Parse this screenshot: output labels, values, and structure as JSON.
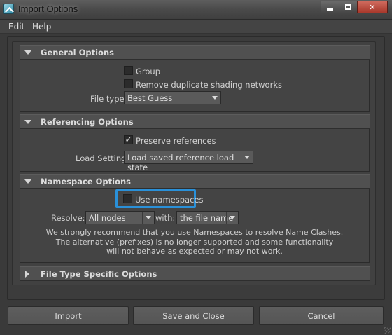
{
  "window": {
    "title": "Import Options"
  },
  "menu": {
    "items": [
      "Edit",
      "Help"
    ]
  },
  "sections": {
    "general": {
      "title": "General Options",
      "group_label": "Group",
      "group_checked": false,
      "remove_dup_label": "Remove duplicate shading networks",
      "remove_dup_checked": false,
      "file_type_label": "File type:",
      "file_type_value": "Best Guess"
    },
    "referencing": {
      "title": "Referencing Options",
      "preserve_label": "Preserve references",
      "preserve_checked": true,
      "load_settings_label": "Load Settings",
      "load_settings_value": "Load saved reference load state"
    },
    "namespace": {
      "title": "Namespace Options",
      "use_ns_label": "Use namespaces",
      "use_ns_checked": false,
      "resolve_label": "Resolve:",
      "resolve_value": "All nodes",
      "with_label": "with:",
      "with_value": "the file name",
      "info_lines": [
        "We strongly recommend that you use Namespaces to resolve Name Clashes.",
        "The alternative (prefixes) is no longer supported and some functionality",
        "will not behave as expected or may not work."
      ]
    },
    "file_type_specific": {
      "title": "File Type Specific Options"
    }
  },
  "buttons": {
    "import": "Import",
    "save_close": "Save and Close",
    "cancel": "Cancel"
  },
  "colors": {
    "highlight": "#2a90d8",
    "background": "#3a3a3a"
  }
}
